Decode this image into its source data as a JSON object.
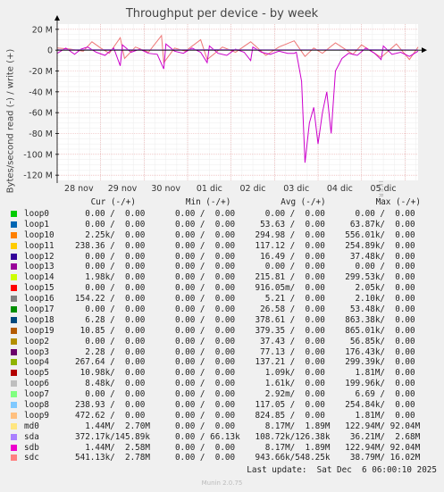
{
  "chart_data": {
    "type": "line",
    "title": "Throughput per device - by week",
    "ylabel": "Bytes/second read (-) / write (+)",
    "y_ticks": [
      "20 M",
      "0",
      "-20 M",
      "-40 M",
      "-60 M",
      "-80 M",
      "-100 M",
      "-120 M"
    ],
    "y_tick_values": [
      20,
      0,
      -20,
      -40,
      -60,
      -80,
      -100,
      -120
    ],
    "ylim": [
      -125,
      25
    ],
    "x_ticks": [
      "28 nov",
      "29 nov",
      "30 nov",
      "01 dic",
      "02 dic",
      "03 dic",
      "04 dic",
      "05 dic"
    ],
    "xlim_days": [
      0,
      8.3
    ],
    "grid": true,
    "series": [
      {
        "name": "sdc",
        "color": "#ee7777",
        "x": [
          0,
          0.3,
          0.6,
          0.8,
          1.0,
          1.2,
          1.45,
          1.55,
          1.8,
          2.1,
          2.4,
          2.45,
          2.7,
          2.95,
          3.3,
          3.45,
          3.8,
          4.1,
          4.45,
          4.8,
          5.1,
          5.45,
          5.7,
          5.9,
          6.1,
          6.4,
          6.8,
          7.0,
          7.45,
          7.8,
          8.1,
          8.3
        ],
        "y": [
          2,
          1,
          -1,
          8,
          2,
          -3,
          12,
          -8,
          3,
          -2,
          14,
          -12,
          2,
          -1,
          10,
          -9,
          3,
          -2,
          8,
          -5,
          3,
          9,
          -6,
          2,
          -3,
          7,
          -4,
          5,
          -7,
          6,
          -9,
          3
        ]
      },
      {
        "name": "sdb",
        "color": "#cc00cc",
        "x": [
          0,
          0.2,
          0.4,
          0.55,
          0.7,
          0.9,
          1.1,
          1.3,
          1.45,
          1.5,
          1.7,
          1.9,
          2.1,
          2.3,
          2.45,
          2.5,
          2.7,
          2.9,
          3.1,
          3.3,
          3.45,
          3.5,
          3.7,
          3.9,
          4.1,
          4.3,
          4.45,
          4.5,
          4.7,
          4.9,
          5.1,
          5.3,
          5.45,
          5.5,
          5.62,
          5.7,
          5.8,
          5.9,
          6.0,
          6.1,
          6.2,
          6.3,
          6.4,
          6.55,
          6.7,
          6.9,
          7.1,
          7.3,
          7.45,
          7.5,
          7.7,
          7.9,
          8.1,
          8.3
        ],
        "y": [
          -3,
          2,
          -4,
          1,
          3,
          -2,
          -5,
          2,
          -15,
          5,
          -2,
          1,
          -3,
          -4,
          -18,
          6,
          -1,
          -3,
          2,
          -2,
          -12,
          4,
          -3,
          -5,
          1,
          -2,
          -10,
          3,
          -2,
          -4,
          -1,
          -3,
          -3,
          -2,
          -30,
          -108,
          -70,
          -55,
          -90,
          -60,
          -40,
          -80,
          -20,
          -8,
          -3,
          -5,
          2,
          -3,
          -9,
          4,
          -4,
          -2,
          -6,
          -1
        ]
      },
      {
        "name": "sda",
        "color": "#aa66ee",
        "x": [
          0,
          1.2,
          2.4,
          3.6,
          4.8,
          5.4,
          6.0,
          7.2,
          8.3
        ],
        "y": [
          0.3,
          0.5,
          0.2,
          0.6,
          0.3,
          0.4,
          0.3,
          0.5,
          0.2
        ]
      }
    ]
  },
  "legend_header": "           Cur (-/+)          Min (-/+)          Avg (-/+)          Max (-/+)",
  "legend": [
    {
      "name": "loop0",
      "color": "#00cc00",
      "values": "  0.00 /  0.00      0.00 /  0.00      0.00 /  0.00      0.00 /  0.00"
    },
    {
      "name": "loop1",
      "color": "#0066b3",
      "values": "  0.00 /  0.00      0.00 /  0.00     53.63 /  0.00     63.87k/  0.00"
    },
    {
      "name": "loop10",
      "color": "#ff8000",
      "values": "  2.25k/  0.00      0.00 /  0.00    294.98 /  0.00    556.01k/  0.00"
    },
    {
      "name": "loop11",
      "color": "#ffcc00",
      "values": "238.36 /  0.00      0.00 /  0.00    117.12 /  0.00    254.89k/  0.00"
    },
    {
      "name": "loop12",
      "color": "#330099",
      "values": "  0.00 /  0.00      0.00 /  0.00     16.49 /  0.00     37.48k/  0.00"
    },
    {
      "name": "loop13",
      "color": "#990099",
      "values": "  0.00 /  0.00      0.00 /  0.00      0.00 /  0.00      0.00 /  0.00"
    },
    {
      "name": "loop14",
      "color": "#ccff00",
      "values": "  1.98k/  0.00      0.00 /  0.00    215.81 /  0.00    299.53k/  0.00"
    },
    {
      "name": "loop15",
      "color": "#ff0000",
      "values": "  0.00 /  0.00      0.00 /  0.00    916.05m/  0.00      2.05k/  0.00"
    },
    {
      "name": "loop16",
      "color": "#808080",
      "values": "154.22 /  0.00      0.00 /  0.00      5.21 /  0.00      2.10k/  0.00"
    },
    {
      "name": "loop17",
      "color": "#008f00",
      "values": "  0.00 /  0.00      0.00 /  0.00     26.58 /  0.00     53.48k/  0.00"
    },
    {
      "name": "loop18",
      "color": "#00487d",
      "values": "  6.28 /  0.00      0.00 /  0.00    378.61 /  0.00    863.38k/  0.00"
    },
    {
      "name": "loop19",
      "color": "#b35a00",
      "values": " 10.85 /  0.00      0.00 /  0.00    379.35 /  0.00    865.01k/  0.00"
    },
    {
      "name": "loop2",
      "color": "#b38f00",
      "values": "  0.00 /  0.00      0.00 /  0.00     37.43 /  0.00     56.85k/  0.00"
    },
    {
      "name": "loop3",
      "color": "#6b006b",
      "values": "  2.28 /  0.00      0.00 /  0.00     77.13 /  0.00    176.43k/  0.00"
    },
    {
      "name": "loop4",
      "color": "#8fb300",
      "values": "267.64 /  0.00      0.00 /  0.00    137.21 /  0.00    299.39k/  0.00"
    },
    {
      "name": "loop5",
      "color": "#b30000",
      "values": " 10.98k/  0.00      0.00 /  0.00      1.09k/  0.00      1.81M/  0.00"
    },
    {
      "name": "loop6",
      "color": "#bebebe",
      "values": "  8.48k/  0.00      0.00 /  0.00      1.61k/  0.00    199.96k/  0.00"
    },
    {
      "name": "loop7",
      "color": "#80ff80",
      "values": "  0.00 /  0.00      0.00 /  0.00      2.92m/  0.00      6.69 /  0.00"
    },
    {
      "name": "loop8",
      "color": "#80c9ff",
      "values": "238.93 /  0.00      0.00 /  0.00    117.05 /  0.00    254.84k/  0.00"
    },
    {
      "name": "loop9",
      "color": "#ffc080",
      "values": "472.62 /  0.00      0.00 /  0.00    824.85 /  0.00      1.81M/  0.00"
    },
    {
      "name": "md0",
      "color": "#ffe680",
      "values": "  1.44M/  2.70M     0.00 /  0.00      8.17M/  1.89M   122.94M/ 92.04M"
    },
    {
      "name": "sda",
      "color": "#aa80ff",
      "values": "372.17k/145.89k     0.00 / 66.13k   108.72k/126.38k    36.21M/  2.68M"
    },
    {
      "name": "sdb",
      "color": "#ee00cc",
      "values": "  1.44M/  2.58M     0.00 /  0.00      8.17M/  1.89M   122.94M/ 92.04M"
    },
    {
      "name": "sdc",
      "color": "#ff8080",
      "values": "541.13k/  2.78M     0.00 /  0.00    943.66k/548.25k    38.79M/ 16.02M"
    }
  ],
  "last_update": "Last update:  Sat Dec  6 06:00:10 2025",
  "watermark": "RRDTOOL / TOBI OETIKER",
  "version": "Munin 2.0.75"
}
